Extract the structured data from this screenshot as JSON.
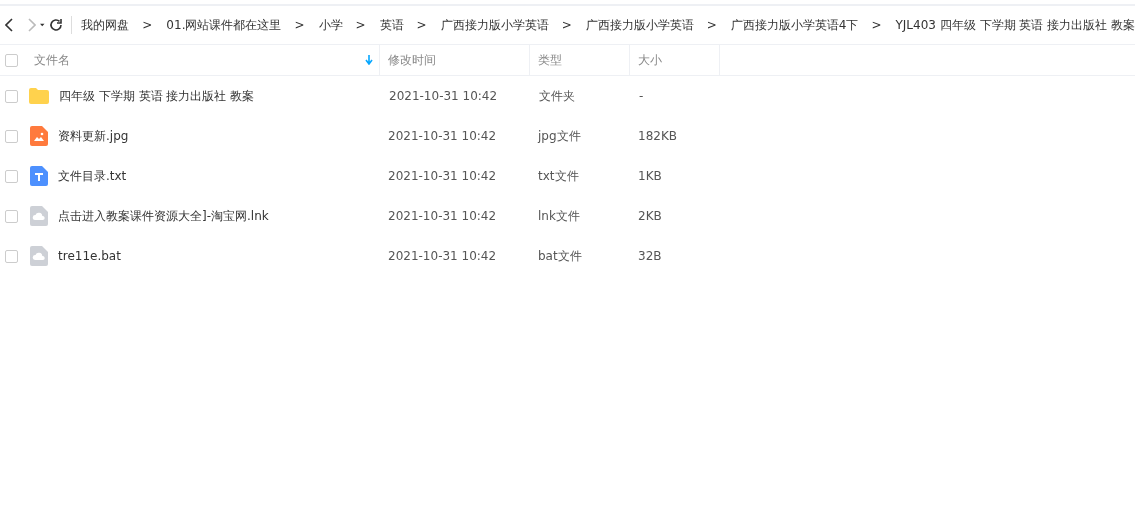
{
  "breadcrumb": [
    "我的网盘",
    "01.网站课件都在这里",
    "小学",
    "英语",
    "广西接力版小学英语",
    "广西接力版小学英语",
    "广西接力版小学英语4下",
    "YJL403 四年级 下学期 英语 接力出版社 教案"
  ],
  "separator": ">",
  "columns": [
    {
      "label": "文件名",
      "sorted": true
    },
    {
      "label": "修改时间",
      "sorted": false
    },
    {
      "label": "类型",
      "sorted": false
    },
    {
      "label": "大小",
      "sorted": false
    }
  ],
  "select_all": {
    "checked": false
  },
  "rows": [
    {
      "kind": "folder",
      "name": "四年级 下学期 英语 接力出版社 教案",
      "modified": "2021-10-31 10:42",
      "type": "文件夹",
      "size": "-",
      "checked": false
    },
    {
      "kind": "image",
      "name": "资料更新.jpg",
      "modified": "2021-10-31 10:42",
      "type": "jpg文件",
      "size": "182KB",
      "checked": false
    },
    {
      "kind": "text",
      "name": "文件目录.txt",
      "modified": "2021-10-31 10:42",
      "type": "txt文件",
      "size": "1KB",
      "checked": false
    },
    {
      "kind": "file",
      "name": "点击进入教案课件资源大全]-淘宝网.lnk",
      "modified": "2021-10-31 10:42",
      "type": "lnk文件",
      "size": "2KB",
      "checked": false
    },
    {
      "kind": "file",
      "name": "tre11e.bat",
      "modified": "2021-10-31 10:42",
      "type": "bat文件",
      "size": "32B",
      "checked": false
    }
  ]
}
